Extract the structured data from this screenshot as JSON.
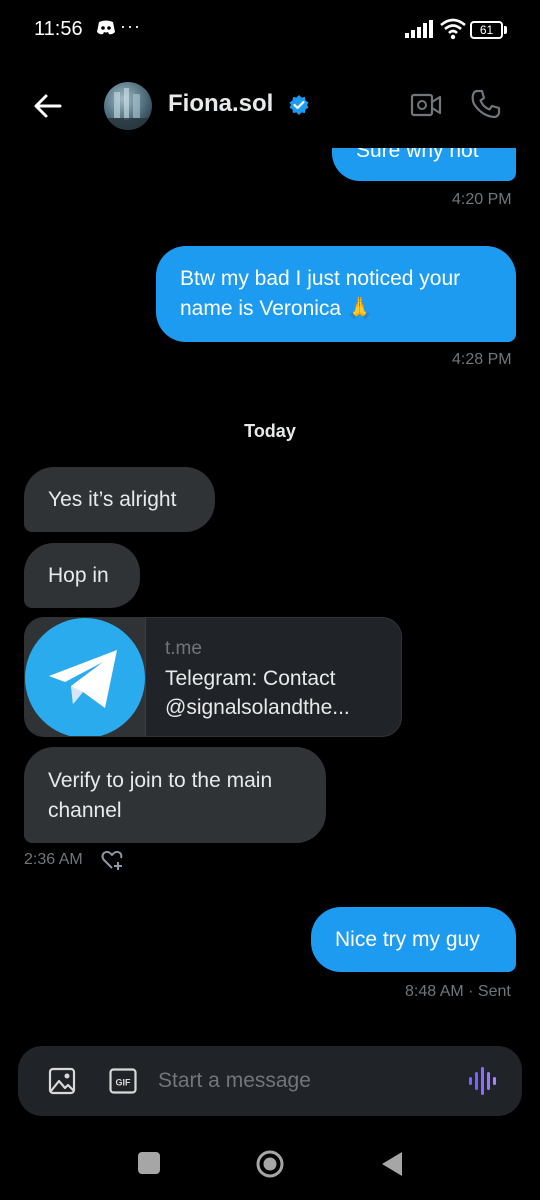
{
  "status_bar": {
    "time": "11:56",
    "dots": "···",
    "battery": "61"
  },
  "header": {
    "contact_name": "Fiona.sol",
    "verified_color": "#1d9bf0"
  },
  "messages": {
    "m1": {
      "text": "Sure why not",
      "meta": "4:20 PM"
    },
    "m2": {
      "text": "Btw my bad I just noticed your name is Veronica 🙏",
      "meta": "4:28 PM"
    },
    "day_separator": "Today",
    "m3": {
      "text": "Yes it’s alright"
    },
    "m4": {
      "text": "Hop in"
    },
    "link_card": {
      "domain": "t.me",
      "title": "Telegram: Contact @signalsolandthe..."
    },
    "m5": {
      "text": "Verify to join to the main channel",
      "meta": "2:36 AM"
    },
    "m6": {
      "text": "Nice try my guy",
      "meta": "8:48 AM · Sent"
    }
  },
  "composer": {
    "placeholder": "Start a message",
    "gif_label": "GIF"
  },
  "colors": {
    "accent": "#1d9bf0",
    "incoming_bubble": "#2f3336",
    "voice_accent": "#7b61ff",
    "telegram": "#2aabee"
  }
}
